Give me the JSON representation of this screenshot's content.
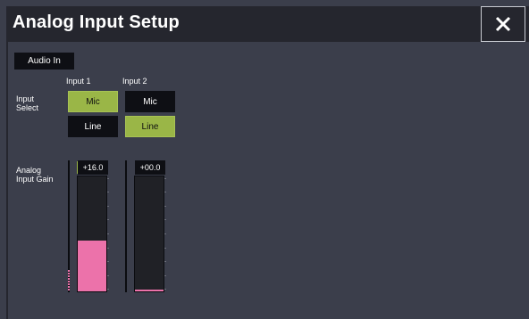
{
  "window": {
    "title": "Analog Input Setup"
  },
  "tab": {
    "label": "Audio In"
  },
  "columns": {
    "input1": "Input 1",
    "input2": "Input 2"
  },
  "input_select": {
    "label_line1": "Input",
    "label_line2": "Select",
    "input1": {
      "mic": "Mic",
      "line": "Line",
      "selected": "Mic"
    },
    "input2": {
      "mic": "Mic",
      "line": "Line",
      "selected": "Line"
    }
  },
  "gain": {
    "label_line1": "Analog",
    "label_line2": "Input Gain",
    "input1": {
      "value_text": "+16.0",
      "level_fraction": 0.44
    },
    "input2": {
      "value_text": "+00.0",
      "level_fraction": 0.0
    }
  },
  "colors": {
    "accent_green": "#9ab647",
    "meter_pink": "#ec72aa",
    "background": "#3b3e4b"
  },
  "icons": {
    "close": "close-icon"
  }
}
